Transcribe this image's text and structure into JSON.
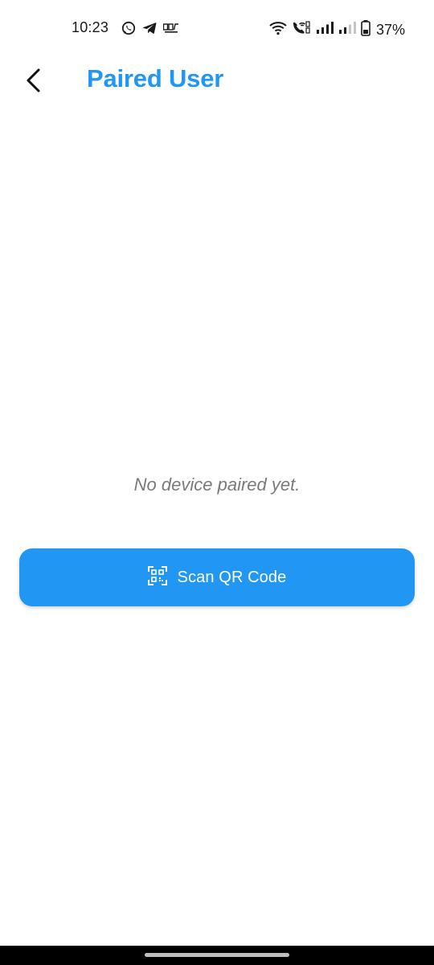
{
  "status_bar": {
    "time": "10:23",
    "left_icons": [
      "whatsapp-icon",
      "telegram-icon",
      "app-notification-icon"
    ],
    "right_icons": [
      "wifi-icon",
      "wifi-calling-icon",
      "signal-icon",
      "signal-weak-icon",
      "battery-icon"
    ],
    "battery_percent": "37%"
  },
  "app_bar": {
    "title": "Paired User"
  },
  "main": {
    "empty_message": "No device paired yet.",
    "scan_button_label": "Scan QR Code",
    "scan_icon": "qr-code-scanner-icon"
  },
  "colors": {
    "accent": "#2196F3",
    "muted_text": "#7a7a7a",
    "background": "#ffffff"
  }
}
